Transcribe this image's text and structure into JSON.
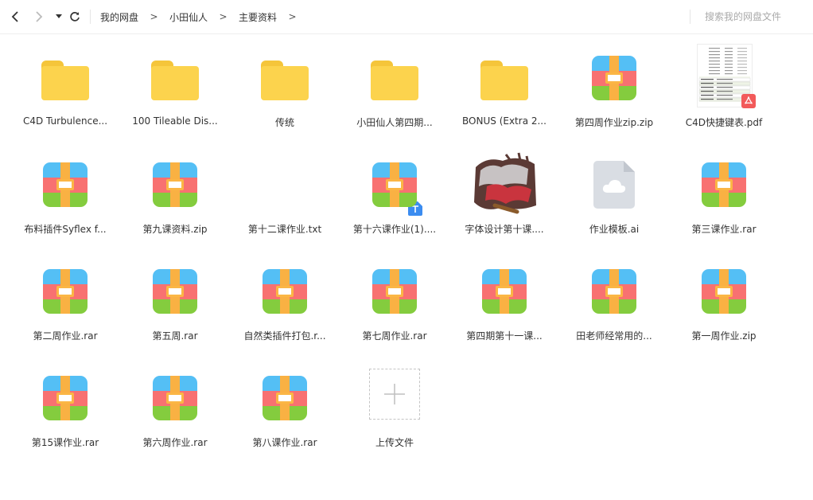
{
  "breadcrumb": [
    "我的网盘",
    "小田仙人",
    "主要资料"
  ],
  "breadcrumb_sep": ">",
  "search": {
    "placeholder": "搜索我的网盘文件"
  },
  "files": [
    {
      "name": "C4D Turbulence...",
      "type": "folder"
    },
    {
      "name": "100 Tileable Dis...",
      "type": "folder"
    },
    {
      "name": "传统",
      "type": "folder"
    },
    {
      "name": "小田仙人第四期...",
      "type": "folder"
    },
    {
      "name": "BONUS (Extra 2...",
      "type": "folder"
    },
    {
      "name": "第四周作业zip.zip",
      "type": "archive"
    },
    {
      "name": "C4D快捷键表.pdf",
      "type": "pdf"
    },
    {
      "name": "布料插件Syflex f...",
      "type": "archive"
    },
    {
      "name": "第九课资料.zip",
      "type": "archive"
    },
    {
      "name": "第十二课作业.txt",
      "type": "txt"
    },
    {
      "name": "第十六课作业(1)....",
      "type": "archive"
    },
    {
      "name": "字体设计第十课....",
      "type": "image"
    },
    {
      "name": "作业模板.ai",
      "type": "ai"
    },
    {
      "name": "第三课作业.rar",
      "type": "archive"
    },
    {
      "name": "第二周作业.rar",
      "type": "archive"
    },
    {
      "name": "第五周.rar",
      "type": "archive"
    },
    {
      "name": "自然类插件打包.r...",
      "type": "archive"
    },
    {
      "name": "第七周作业.rar",
      "type": "archive"
    },
    {
      "name": "第四期第十一课...",
      "type": "archive"
    },
    {
      "name": "田老师经常用的...",
      "type": "archive"
    },
    {
      "name": "第一周作业.zip",
      "type": "archive"
    },
    {
      "name": "第15课作业.rar",
      "type": "archive"
    },
    {
      "name": "第六周作业.rar",
      "type": "archive"
    },
    {
      "name": "第八课作业.rar",
      "type": "archive"
    }
  ],
  "upload": {
    "label": "上传文件"
  },
  "colors": {
    "folder": "#fcd34d",
    "archive_blue": "#54bff5",
    "archive_red": "#f87171",
    "archive_green": "#84cc3e",
    "archive_strap": "#f9b143",
    "pdf_badge": "#f25a5a",
    "txt_badge": "#3b8cf0"
  }
}
